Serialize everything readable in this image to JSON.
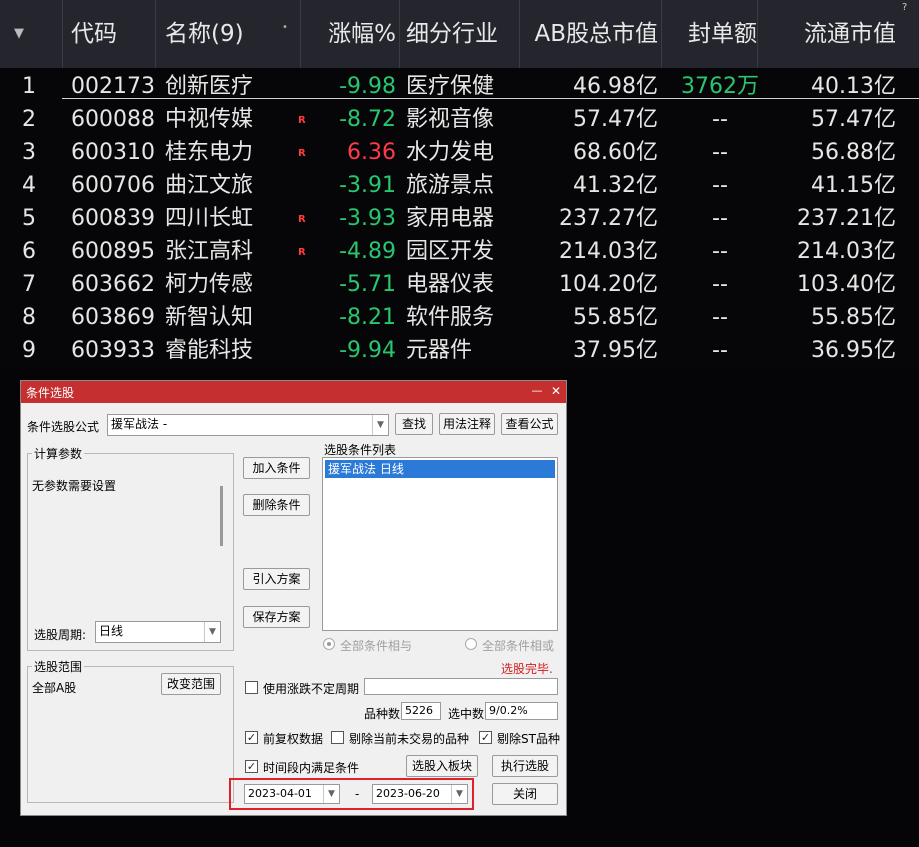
{
  "table": {
    "menu_icon": "triangle-down",
    "help_icon": "?",
    "headers": {
      "code": "代码",
      "name": "名称(9)",
      "sort_mark": "•",
      "change": "涨幅%",
      "industry": "细分行业",
      "total_mv": "AB股总市值",
      "seal": "封单额",
      "float_mv": "流通市值"
    },
    "rows": [
      {
        "idx": "1",
        "code": "002173",
        "name": "创新医疗",
        "flag": "",
        "change": "-9.98",
        "industry": "医疗保健",
        "total_mv": "46.98亿",
        "seal": "3762万",
        "float_mv": "40.13亿"
      },
      {
        "idx": "2",
        "code": "600088",
        "name": "中视传媒",
        "flag": "R",
        "change": "-8.72",
        "industry": "影视音像",
        "total_mv": "57.47亿",
        "seal": "--",
        "float_mv": "57.47亿"
      },
      {
        "idx": "3",
        "code": "600310",
        "name": "桂东电力",
        "flag": "R",
        "change": "6.36",
        "industry": "水力发电",
        "total_mv": "68.60亿",
        "seal": "--",
        "float_mv": "56.88亿"
      },
      {
        "idx": "4",
        "code": "600706",
        "name": "曲江文旅",
        "flag": "",
        "change": "-3.91",
        "industry": "旅游景点",
        "total_mv": "41.32亿",
        "seal": "--",
        "float_mv": "41.15亿"
      },
      {
        "idx": "5",
        "code": "600839",
        "name": "四川长虹",
        "flag": "R",
        "change": "-3.93",
        "industry": "家用电器",
        "total_mv": "237.27亿",
        "seal": "--",
        "float_mv": "237.21亿"
      },
      {
        "idx": "6",
        "code": "600895",
        "name": "张江高科",
        "flag": "R",
        "change": "-4.89",
        "industry": "园区开发",
        "total_mv": "214.03亿",
        "seal": "--",
        "float_mv": "214.03亿"
      },
      {
        "idx": "7",
        "code": "603662",
        "name": "柯力传感",
        "flag": "",
        "change": "-5.71",
        "industry": "电器仪表",
        "total_mv": "104.20亿",
        "seal": "--",
        "float_mv": "103.40亿"
      },
      {
        "idx": "8",
        "code": "603869",
        "name": "新智认知",
        "flag": "",
        "change": "-8.21",
        "industry": "软件服务",
        "total_mv": "55.85亿",
        "seal": "--",
        "float_mv": "55.85亿"
      },
      {
        "idx": "9",
        "code": "603933",
        "name": "睿能科技",
        "flag": "",
        "change": "-9.94",
        "industry": "元器件",
        "total_mv": "37.95亿",
        "seal": "--",
        "float_mv": "36.95亿"
      }
    ]
  },
  "dialog": {
    "title": "条件选股",
    "minimize": "—",
    "close": "✕",
    "formula_label": "条件选股公式",
    "formula_value": "援军战法      -",
    "find_btn": "查找",
    "usage_btn": "用法注释",
    "view_btn": "查看公式",
    "calc_group": "计算参数",
    "no_params": "无参数需要设置",
    "period_label": "选股周期:",
    "period_value": "日线",
    "add_btn": "加入条件",
    "delete_btn": "删除条件",
    "import_btn": "引入方案",
    "save_btn": "保存方案",
    "list_title": "选股条件列表",
    "list_items": [
      "援军战法  日线"
    ],
    "radio_and": "全部条件相与",
    "radio_or": "全部条件相或",
    "status": "选股完毕.",
    "range_group": "选股范围",
    "range_value": "全部A股",
    "change_range_btn": "改变范围",
    "use_period_label": "使用涨跌不定周期",
    "count_label": "品种数",
    "count_value": "5226",
    "selected_label": "选中数",
    "selected_value": "9/0.2%",
    "fq_label": "前复权数据",
    "exclude_untraded_label": "剔除当前未交易的品种",
    "exclude_st_label": "剔除ST品种",
    "time_range_label": "时间段内满足条件",
    "to_block_btn": "选股入板块",
    "run_btn": "执行选股",
    "date_from": "2023-04-01",
    "date_sep": "-",
    "date_to": "2023-06-20",
    "close_btn": "关闭",
    "check_mark": "✓"
  }
}
